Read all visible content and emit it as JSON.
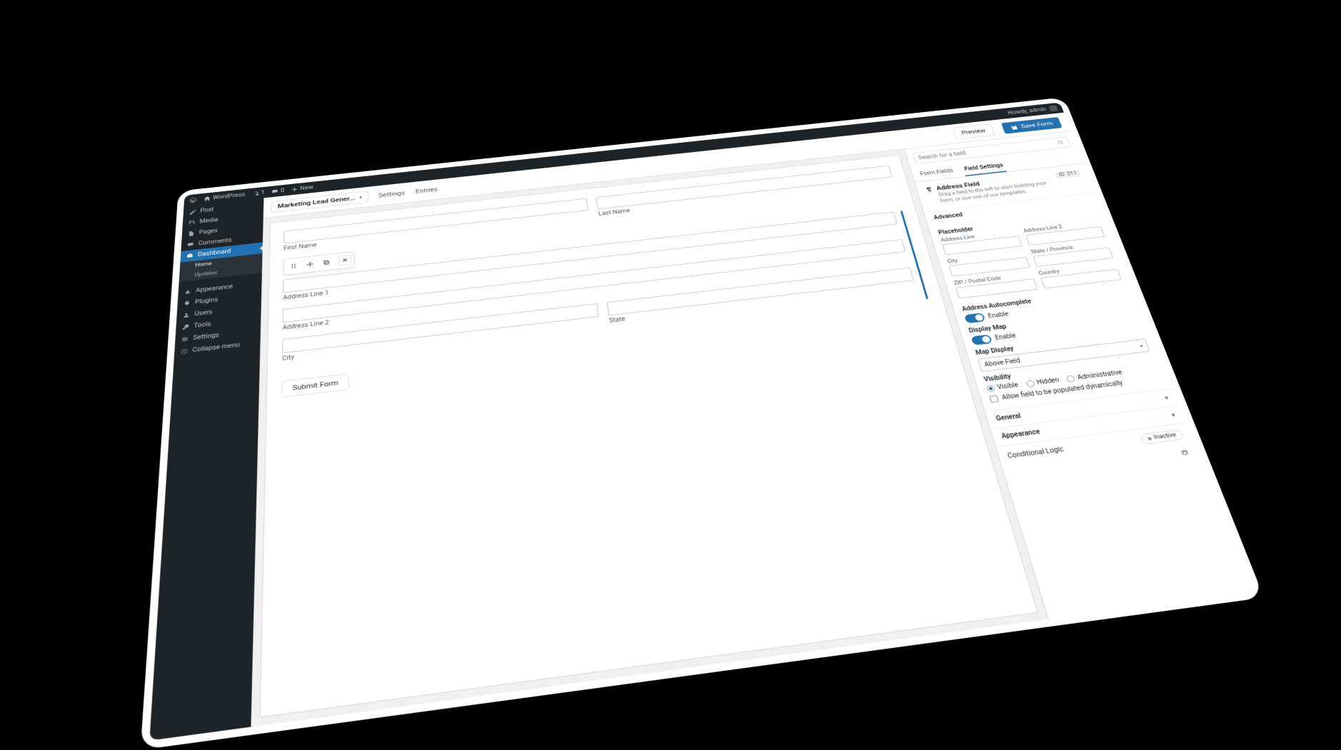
{
  "adminbar": {
    "site": "WordPress",
    "updates": "1",
    "comments": "0",
    "new": "New",
    "howdy": "Howdy, admin"
  },
  "sidebar": {
    "posts": "Post",
    "media": "Media",
    "pages": "Pages",
    "comments": "Comments",
    "dashboard": "Dashboard",
    "home": "Home",
    "updates": "Updates",
    "appearance": "Appearance",
    "plugins": "Plugins",
    "users": "Users",
    "tools": "Tools",
    "settings": "Settings",
    "collapse": "Collapse menu"
  },
  "topbar": {
    "form_name": "Marketing Lead Gener...",
    "settings": "Settings",
    "entries": "Entries",
    "preview": "Preview",
    "save": "Save Form"
  },
  "canvas": {
    "first_name": "First Name",
    "last_name": "Last Name",
    "addr1": "Address Line 1",
    "addr2": "Address Line 2",
    "city": "City",
    "state": "State",
    "submit": "Submit Form"
  },
  "panel": {
    "search_ph": "Search for a field",
    "tab_fields": "Form Fields",
    "tab_settings": "Field Settings",
    "field_title": "Address Field",
    "id_badge": "ID: 211",
    "hint": "Drag a field to the left to start building your form, or use one of our templates.",
    "advanced": "Advanced",
    "placeholder": "Placeholder",
    "ph_addr": "Address Line",
    "ph_addr2": "Address Line 2",
    "ph_city": "City",
    "ph_state": "State / Province",
    "ph_zip": "ZIP / Postal Code",
    "ph_country": "Country",
    "autocomplete": "Address Autocomplete",
    "enable": "Enable",
    "display_map": "Display Map",
    "map_display": "Map Display",
    "map_display_val": "Above Field",
    "visibility": "Visibility",
    "vis_visible": "Visible",
    "vis_hidden": "Hidden",
    "vis_admin": "Administrative",
    "allow_dyn": "Allow field to be populated dynamically",
    "general": "General",
    "appearance": "Appearance",
    "cond_logic": "Conditional Logic",
    "inactive": "Inactive"
  }
}
